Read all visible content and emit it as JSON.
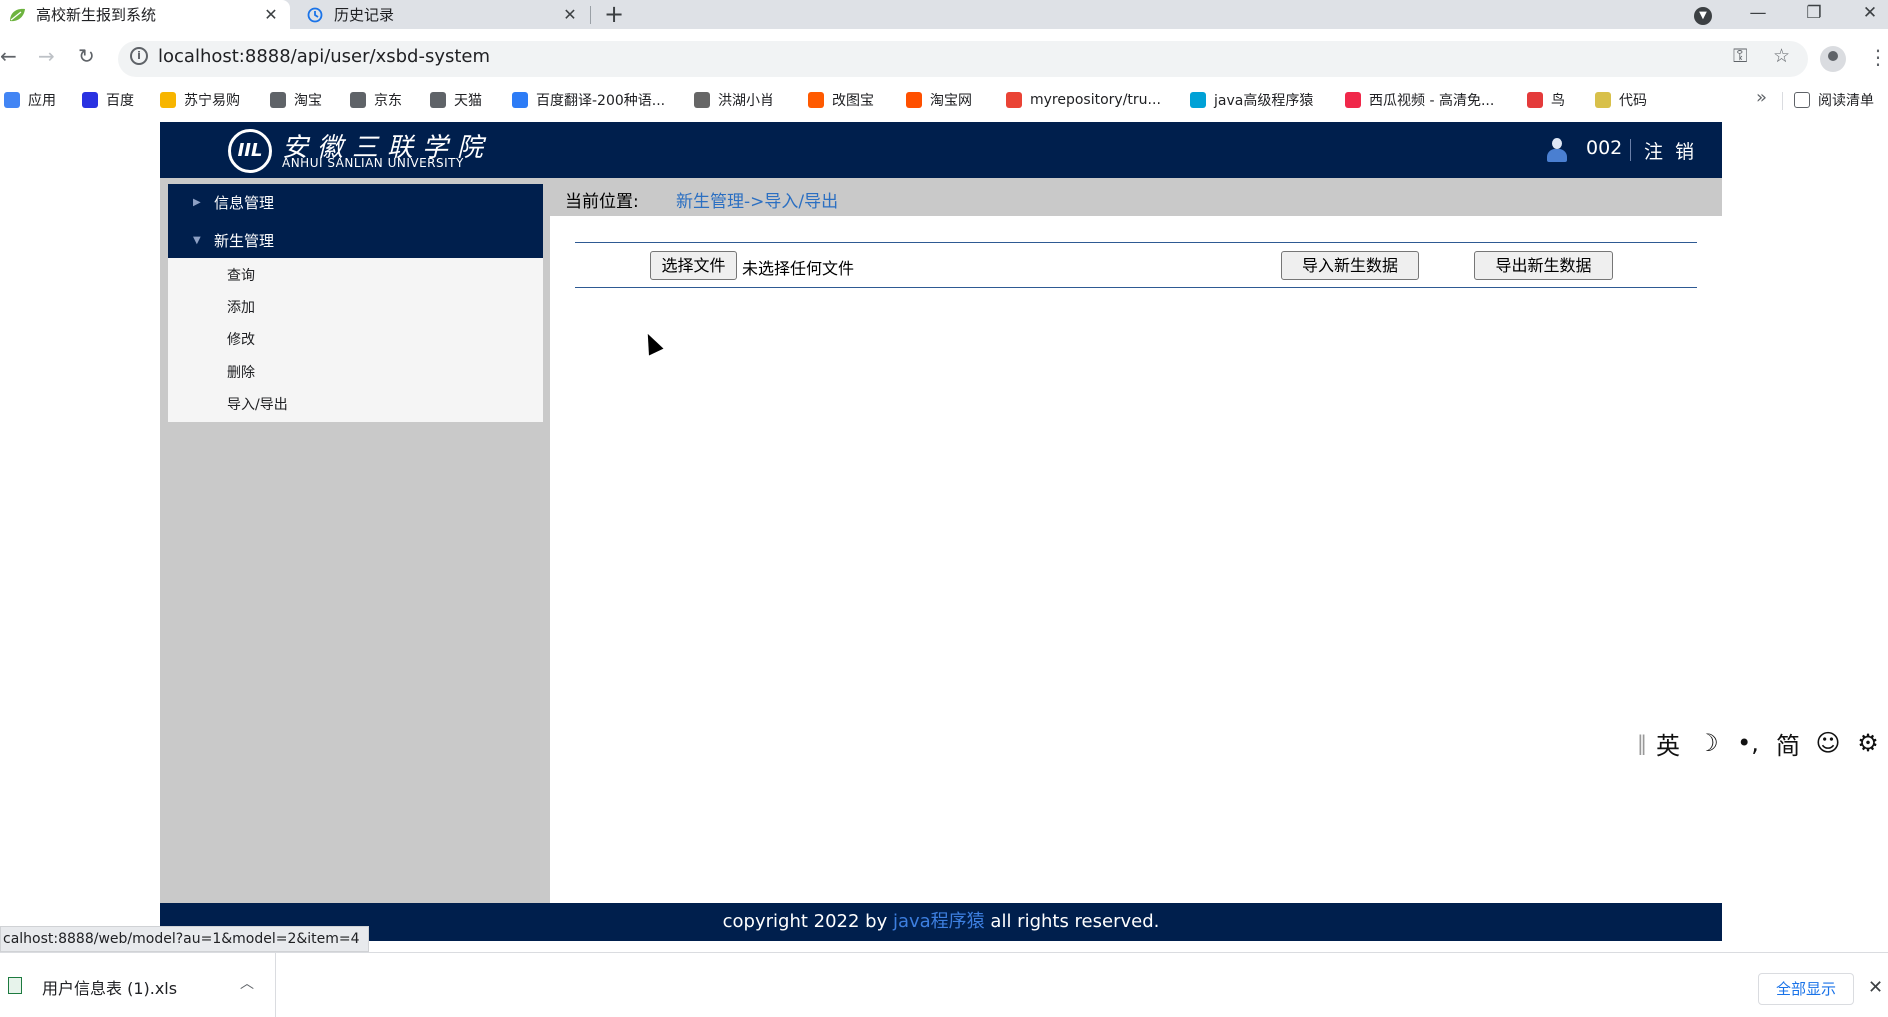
{
  "browser": {
    "tabs": [
      {
        "title": "高校新生报到系统",
        "icon": "leaf-icon",
        "active": true
      },
      {
        "title": "历史记录",
        "icon": "history-icon",
        "active": false
      }
    ],
    "new_tab": "+",
    "window_controls": {
      "minimize": "—",
      "maximize": "❐",
      "close": "✕"
    },
    "url": "localhost:8888/api/user/xsbd-system",
    "bookmarks": [
      {
        "label": "应用",
        "icon": "apps-grid-icon",
        "color": "#4285f4"
      },
      {
        "label": "百度",
        "icon": "baidu-paw-icon",
        "color": "#2932e1"
      },
      {
        "label": "苏宁易购",
        "icon": "suning-icon",
        "color": "#f7b500"
      },
      {
        "label": "淘宝",
        "icon": "globe-icon",
        "color": "#5f6368"
      },
      {
        "label": "京东",
        "icon": "globe-icon",
        "color": "#5f6368"
      },
      {
        "label": "天猫",
        "icon": "globe-icon",
        "color": "#5f6368"
      },
      {
        "label": "百度翻译-200种语...",
        "icon": "translate-icon",
        "color": "#2d7cf6"
      },
      {
        "label": "洪湖小肖",
        "icon": "feather-icon",
        "color": "#666666"
      },
      {
        "label": "改图宝",
        "icon": "image-icon",
        "color": "#ff5a00"
      },
      {
        "label": "淘宝网",
        "icon": "taobao-icon",
        "color": "#ff5000"
      },
      {
        "label": "myrepository/tru...",
        "icon": "chrome-icon",
        "color": "#ea4335"
      },
      {
        "label": "java高级程序猿",
        "icon": "bilibili-icon",
        "color": "#00a1d6"
      },
      {
        "label": "西瓜视频 - 高清免...",
        "icon": "xigua-icon",
        "color": "#f0284a"
      },
      {
        "label": "鸟",
        "icon": "bird-icon",
        "color": "#e43b3b"
      },
      {
        "label": "代码",
        "icon": "code-icon",
        "color": "#d8c04a"
      }
    ],
    "bookmarks_more": "»",
    "reading_list": "阅读清单"
  },
  "site": {
    "logo_cn": "安徽三联学院",
    "logo_en": "ANHUI SANLIAN UNIVERSITY",
    "logo_mark": "IIL",
    "user_id": "002",
    "logout": "注销",
    "sidebar": {
      "groups": [
        {
          "label": "信息管理",
          "expanded": false
        },
        {
          "label": "新生管理",
          "expanded": true
        }
      ],
      "items": [
        "查询",
        "添加",
        "修改",
        "删除",
        "导入/导出"
      ]
    },
    "breadcrumb": {
      "label": "当前位置:",
      "path": "新生管理->导入/导出"
    },
    "import": {
      "choose_file": "选择文件",
      "file_status": "未选择任何文件",
      "import_button": "导入新生数据",
      "export_button": "导出新生数据"
    },
    "footer": {
      "prefix": "copyright 2022 by ",
      "link": "java程序猿",
      "suffix": " all rights reserved."
    },
    "colors": {
      "header_bg": "#001f4d",
      "sidebar_bg": "#c9c9c9",
      "link": "#2b6fc2"
    }
  },
  "status_bar": {
    "url": "calhost:8888/web/model?au=1&model=2&item=4"
  },
  "ime": {
    "items": [
      "英",
      "☽",
      "•,",
      "简",
      "☺",
      "⚙"
    ]
  },
  "downloads": {
    "file_name": "用户信息表 (1).xls",
    "show_all": "全部显示",
    "close": "✕"
  }
}
